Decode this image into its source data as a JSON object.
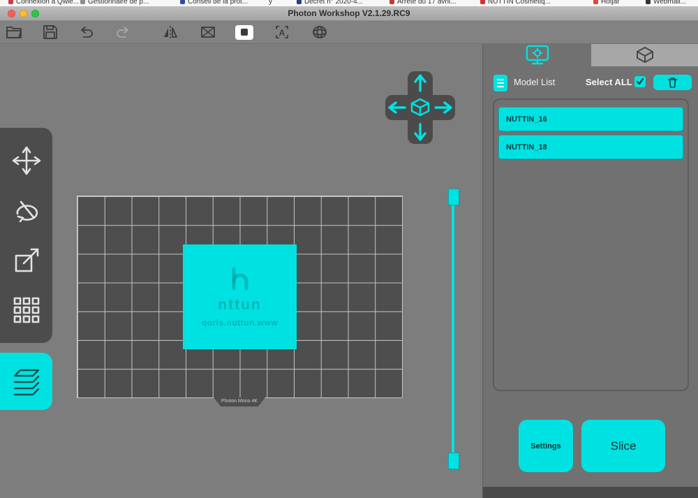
{
  "colors": {
    "accent": "#00e2e2"
  },
  "bookmarks_bar": {
    "items": [
      {
        "label": "Connexion à Qwle...",
        "favicon_color": "#d63b3b"
      },
      {
        "label": "Gestionnaire de p...",
        "favicon_color": "#8a8f98"
      },
      {
        "label": "Conseil de la prot...",
        "favicon_color": "#2d4f9e"
      },
      {
        "label": "y",
        "favicon_color": "#b5352f"
      },
      {
        "label": "Décret n° 2020-4...",
        "favicon_color": "#27408f"
      },
      {
        "label": "Arrêté du 17 avril...",
        "favicon_color": "#c23b36"
      },
      {
        "label": "NUTTIN Cosmétiq...",
        "favicon_color": "#d0342c"
      },
      {
        "label": "Hotjar",
        "favicon_color": "#e0463c"
      },
      {
        "label": "Webmail...",
        "favicon_color": "#30343c"
      }
    ]
  },
  "titlebar": {
    "title": "Photon Workshop V2.1.29.RC9"
  },
  "toolbar": {
    "tools": [
      "open",
      "save",
      "undo",
      "redo",
      "mirror",
      "transform",
      "plate",
      "text",
      "mesh"
    ],
    "text_tool_glyph": "A"
  },
  "left_toolbar": {
    "tools": [
      "move",
      "rotate",
      "scale",
      "clone-array",
      "slice-layers"
    ]
  },
  "viewport": {
    "plate_label": "Photon Mono 4K",
    "model": {
      "logo_text": "nttun",
      "url_text": "qorls.nuttun.www"
    }
  },
  "right_panel": {
    "tabs": [
      {
        "name": "model-settings",
        "active": true
      },
      {
        "name": "print-preview",
        "active": false
      }
    ],
    "header": {
      "title": "Model List",
      "select_all_label": "Select ALL",
      "select_all_checked": true
    },
    "model_list": [
      {
        "name": "NUTTIN_16"
      },
      {
        "name": "NUTTIN_18"
      }
    ],
    "buttons": {
      "settings": "Settings",
      "slice": "Slice"
    }
  }
}
